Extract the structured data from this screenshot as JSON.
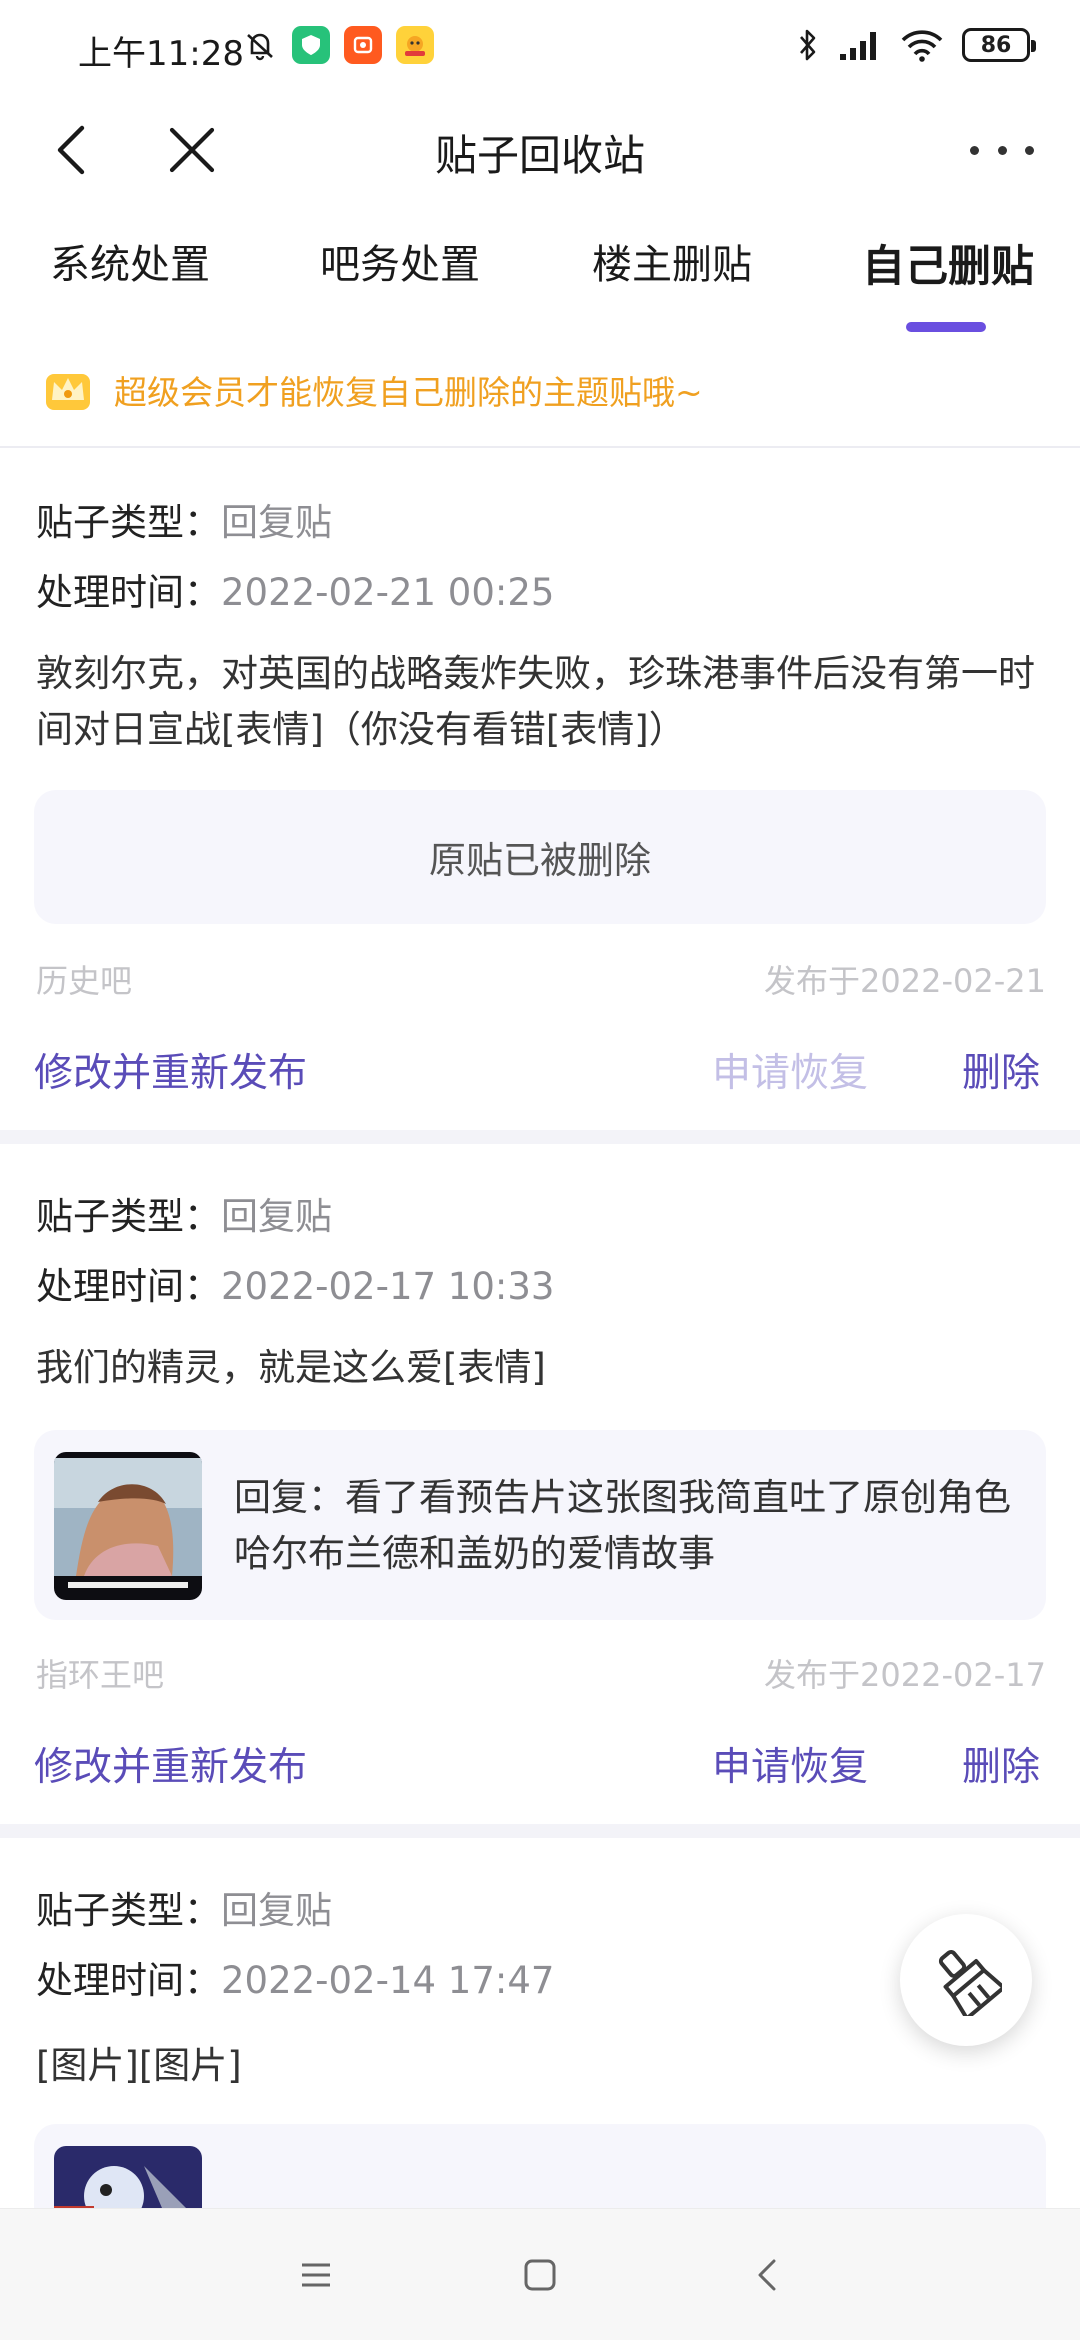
{
  "status_bar": {
    "time": "上午11:28",
    "battery": "86",
    "icons_left": [
      "mute-bell-icon",
      "shield-app-icon",
      "taobao-app-icon",
      "mascot-app-icon"
    ],
    "icons_right": [
      "bluetooth-icon",
      "signal-icon",
      "wifi-icon",
      "battery-icon"
    ]
  },
  "nav": {
    "title": "贴子回收站"
  },
  "tabs": [
    {
      "label": "系统处置",
      "active": false
    },
    {
      "label": "吧务处置",
      "active": false
    },
    {
      "label": "楼主删贴",
      "active": false
    },
    {
      "label": "自己删贴",
      "active": true
    }
  ],
  "notice": {
    "text": "超级会员才能恢复自己删除的主题贴哦~"
  },
  "colors": {
    "accent": "#6a4fe0",
    "action": "#5a4cb8",
    "notice": "#f0a020"
  },
  "posts": [
    {
      "type_label": "贴子类型：",
      "type_value": "回复贴",
      "time_label": "处理时间：",
      "time_value": "2022-02-21 00:25",
      "content": "敦刻尔克，对英国的战略轰炸失败，珍珠港事件后没有第一时间对日宣战[表情]（你没有看错[表情]）",
      "original": "原贴已被删除",
      "forum": "历史吧",
      "published": "发布于2022-02-21",
      "edit_label": "修改并重新发布",
      "restore_label": "申请恢复",
      "delete_label": "删除"
    },
    {
      "type_label": "贴子类型：",
      "type_value": "回复贴",
      "time_label": "处理时间：",
      "time_value": "2022-02-17 10:33",
      "content": "我们的精灵，就是这么爱[表情]",
      "quote": "回复：看了看预告片这张图我简直吐了原创角色哈尔布兰德和盖奶的爱情故事",
      "forum": "指环王吧",
      "published": "发布于2022-02-17",
      "edit_label": "修改并重新发布",
      "restore_label": "申请恢复",
      "delete_label": "删除"
    },
    {
      "type_label": "贴子类型：",
      "type_value": "回复贴",
      "time_label": "处理时间：",
      "time_value": "2022-02-14 17:47",
      "content": "[图片][图片]"
    }
  ]
}
